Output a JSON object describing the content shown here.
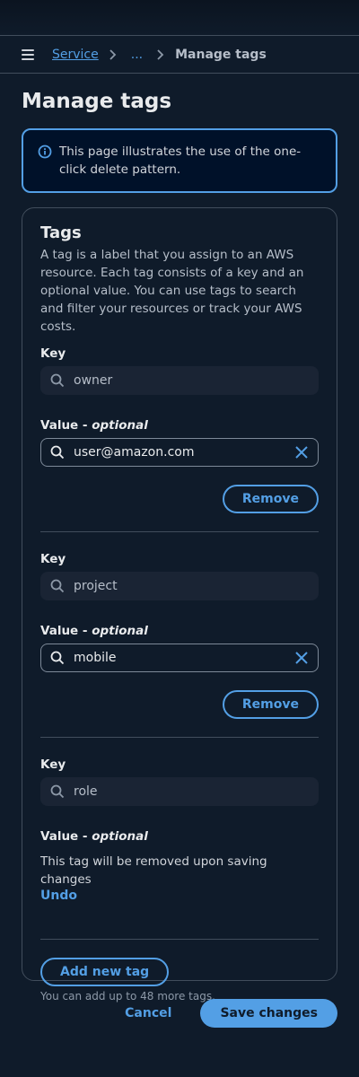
{
  "breadcrumb": {
    "root": "Service",
    "ellipsis": "...",
    "current": "Manage tags"
  },
  "page_title": "Manage tags",
  "alert": {
    "text": "This page illustrates the use of the one-click delete pattern."
  },
  "tags_section": {
    "title": "Tags",
    "description": "A tag is a label that you assign to an AWS resource. Each tag consists of a key and an optional value. You can use tags to search and filter your resources or track your AWS costs.",
    "key_label": "Key",
    "value_label": "Value - ",
    "value_optional": "optional",
    "remove_label": "Remove"
  },
  "tags": [
    {
      "key": "owner",
      "value": "user@amazon.com"
    },
    {
      "key": "project",
      "value": "mobile"
    },
    {
      "key": "role",
      "removed_message": "This tag will be removed upon saving changes",
      "undo_label": "Undo"
    }
  ],
  "add_tag": {
    "label": "Add new tag",
    "limit_text": "You can add up to 48 more tags."
  },
  "footer": {
    "cancel_label": "Cancel",
    "save_label": "Save changes"
  },
  "colors": {
    "background": "#0f1b2a",
    "accent": "#539fe5",
    "border": "#414d5c"
  },
  "icons": [
    "menu-icon",
    "chevron-right-icon",
    "info-icon",
    "search-icon",
    "clear-icon"
  ]
}
